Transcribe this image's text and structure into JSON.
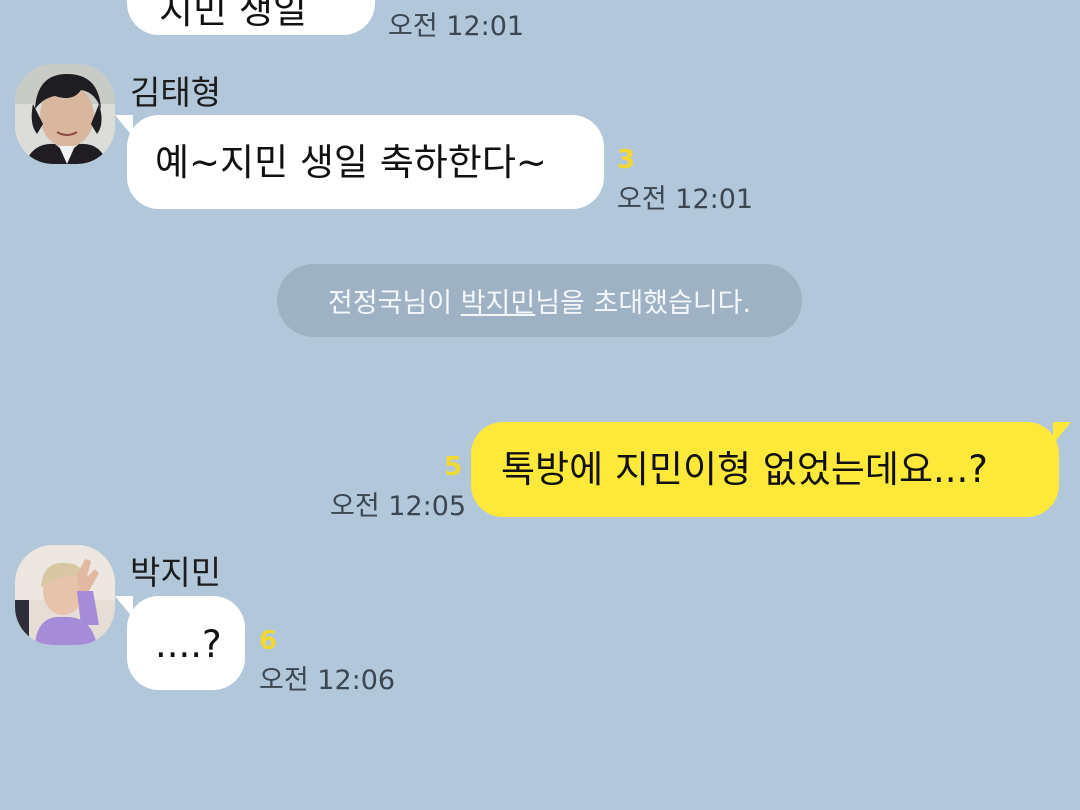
{
  "colors": {
    "background": "#b2c7da",
    "incoming_bubble": "#ffffff",
    "outgoing_bubble": "#fee93b",
    "system_pill": "#9fb2c3",
    "unread_count": "#f2d832",
    "timestamp": "#3b4650"
  },
  "messages": {
    "m0": {
      "partial_text": "지민 생일",
      "time": "오전 12:01"
    },
    "m1": {
      "sender": "김태형",
      "avatar_icon": "profile-photo-kim-taehyung",
      "text": "예~지민 생일 축하한다~",
      "unread": "3",
      "time": "오전 12:01"
    },
    "system": {
      "inviter": "전정국님이 ",
      "invitee": "박지민",
      "action": "님을 초대했습니다."
    },
    "m2": {
      "text": "톡방에 지민이형 없었는데요...?",
      "unread": "5",
      "time": "오전 12:05"
    },
    "m3": {
      "sender": "박지민",
      "avatar_icon": "profile-photo-park-jimin",
      "text": "....?",
      "unread": "6",
      "time": "오전 12:06"
    }
  }
}
